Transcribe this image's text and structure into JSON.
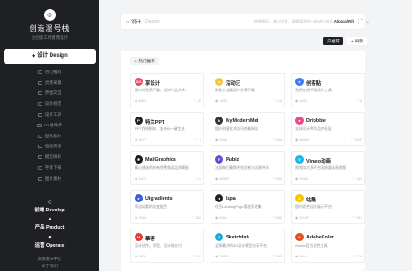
{
  "brand": {
    "name": "创造湿号栈",
    "subtitle": "为创意工作者而设计"
  },
  "sidebar": {
    "active": {
      "label": "设计 Design",
      "icon": "design-icon"
    },
    "items": [
      {
        "label": "热门推荐"
      },
      {
        "label": "灵感采集"
      },
      {
        "label": "界面交互"
      },
      {
        "label": "设计规范"
      },
      {
        "label": "设计工具"
      },
      {
        "label": "UI 组件库"
      },
      {
        "label": "图标素材"
      },
      {
        "label": "插画资源"
      },
      {
        "label": "模型样机"
      },
      {
        "label": "字体下载"
      },
      {
        "label": "图片素材"
      }
    ],
    "categories": [
      {
        "label": "前端 Develop",
        "icon": "develop-icon"
      },
      {
        "label": "产品 Product",
        "icon": "product-icon"
      },
      {
        "label": "运营 Operate",
        "icon": "operate-icon"
      }
    ],
    "footer": [
      "资源发布中心",
      "关于我们"
    ]
  },
  "search": {
    "category": "设计",
    "placeholder": "Design",
    "hint_prefix": "· 热键搜索，减少切换，高频搜索的一站进行访问",
    "hint_key": "Alpaca(Rd)"
  },
  "toggles": {
    "dark": "只推荐",
    "light": "↪ 刷新"
  },
  "section_tag": "热门推荐",
  "cards": [
    {
      "title": "享设计",
      "desc": "国内外免费下载，设计作品共享...",
      "views": "4825",
      "likes": "23",
      "color": "#e84a5f",
      "icon_char": "DO"
    },
    {
      "title": "活动汪",
      "desc": "彩绘大全展设计分享下载",
      "views": "4490",
      "likes": "14",
      "color": "#f6c343",
      "icon_char": "●"
    },
    {
      "title": "创客贴",
      "desc": "免费在线平面设计工具",
      "views": "3460",
      "likes": "11",
      "color": "#3d7cf5",
      "icon_char": "●"
    },
    {
      "title": "特兰PPT",
      "desc": "PPT在线制作，支持AI一键生成",
      "views": "1677",
      "likes": "3",
      "color": "#222222",
      "icon_char": "P"
    },
    {
      "title": "MyModernMet",
      "desc": "国外创意艺术资讯合集网站",
      "views": "5346",
      "likes": "183",
      "color": "#333333",
      "icon_char": "M"
    },
    {
      "title": "Dribbble",
      "desc": "全球设计师作品库社区",
      "views": "84659",
      "likes": "1447",
      "color": "#ea4c89",
      "icon_char": "●"
    },
    {
      "title": "MaliGraphics",
      "desc": "精心挑选的所有免费和高品质模板",
      "views": "1473",
      "likes": "14",
      "color": "#1a1a1a",
      "icon_char": "✱"
    },
    {
      "title": "Pubiz",
      "desc": "法国每日最鲜视觉灵感与资源共享",
      "views": "66992",
      "likes": "182",
      "color": "#6b4bd6",
      "icon_char": "P"
    },
    {
      "title": "Vimeo动画",
      "desc": "视频和大多平台高质量动画视频",
      "views": "90911",
      "likes": "321",
      "color": "#1ab7ea",
      "icon_char": "V"
    },
    {
      "title": "Uigradients",
      "desc": "简洁好看的渐变配色",
      "views": "7649",
      "likes": "227",
      "color": "#3a5fd9",
      "icon_char": "●"
    },
    {
      "title": "lapa",
      "desc": "优秀LandingPage落地页收集",
      "views": "8041",
      "likes": "186",
      "color": "#222222",
      "icon_char": "●"
    },
    {
      "title": "站酷",
      "desc": "国内综合设计展示平台",
      "views": "19197",
      "likes": "514",
      "color": "#f2c300",
      "icon_char": "Z"
    },
    {
      "title": "摹客",
      "desc": "设计协作，原型、设计稿交付",
      "views": "9823",
      "likes": "473",
      "color": "#e6392f",
      "icon_char": "M"
    },
    {
      "title": "Sketchfab",
      "desc": "全球最大的3D设计模型分享平台",
      "views": "33552",
      "likes": "283",
      "color": "#1caad9",
      "icon_char": "S"
    },
    {
      "title": "AdobeColor",
      "desc": "Adobe官方配色工具",
      "views": "6919",
      "likes": "225",
      "color": "#e34f26",
      "icon_char": "A"
    }
  ]
}
